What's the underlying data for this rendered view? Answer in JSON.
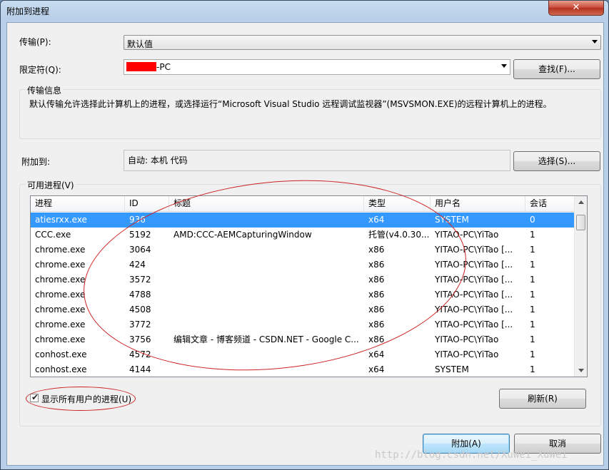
{
  "window": {
    "title": "附加到进程",
    "close_glyph": "✕"
  },
  "transport": {
    "label": "传输(P):",
    "value": "默认值"
  },
  "qualifier": {
    "label": "限定符(Q):",
    "value": "-PC",
    "find_button": "查找(F)..."
  },
  "transport_info": {
    "title": "传输信息",
    "text": "默认传输允许选择此计算机上的进程，或选择运行“Microsoft Visual Studio 远程调试监视器”(MSVSMON.EXE)的远程计算机上的进程。"
  },
  "attach_to": {
    "label": "附加到:",
    "value": "自动: 本机 代码",
    "select_button": "选择(S)..."
  },
  "processes": {
    "title": "可用进程(V)",
    "columns": [
      "进程",
      "ID",
      "标题",
      "类型",
      "用户名",
      "会话"
    ],
    "rows": [
      {
        "name": "atiesrxx.exe",
        "id": "936",
        "title": "",
        "type": "x64",
        "user": "SYSTEM",
        "session": "0"
      },
      {
        "name": "CCC.exe",
        "id": "5192",
        "title": "AMD:CCC-AEMCapturingWindow",
        "type": "托管(v4.0.30...",
        "user": "YITAO-PC\\YiTao",
        "session": "1"
      },
      {
        "name": "chrome.exe",
        "id": "3064",
        "title": "",
        "type": "x86",
        "user": "YITAO-PC\\YiTao [...",
        "session": "1"
      },
      {
        "name": "chrome.exe",
        "id": "424",
        "title": "",
        "type": "x86",
        "user": "YITAO-PC\\YiTao [...",
        "session": "1"
      },
      {
        "name": "chrome.exe",
        "id": "3572",
        "title": "",
        "type": "x86",
        "user": "YITAO-PC\\YiTao [...",
        "session": "1"
      },
      {
        "name": "chrome.exe",
        "id": "4788",
        "title": "",
        "type": "x86",
        "user": "YITAO-PC\\YiTao [...",
        "session": "1"
      },
      {
        "name": "chrome.exe",
        "id": "4508",
        "title": "",
        "type": "x86",
        "user": "YITAO-PC\\YiTao [...",
        "session": "1"
      },
      {
        "name": "chrome.exe",
        "id": "3772",
        "title": "",
        "type": "x86",
        "user": "YITAO-PC\\YiTao [...",
        "session": "1"
      },
      {
        "name": "chrome.exe",
        "id": "3756",
        "title": "编辑文章 - 博客频道 - CSDN.NET - Google C...",
        "type": "x86",
        "user": "YITAO-PC\\YiTao",
        "session": "1"
      },
      {
        "name": "conhost.exe",
        "id": "4572",
        "title": "",
        "type": "x64",
        "user": "YITAO-PC\\YiTao",
        "session": "1"
      },
      {
        "name": "conhost.exe",
        "id": "4144",
        "title": "",
        "type": "x64",
        "user": "SYSTEM",
        "session": "1"
      }
    ],
    "selected_index": 0,
    "show_all_users": {
      "label": "显示所有用户的进程(U)",
      "checked": true
    },
    "refresh_button": "刷新(R)"
  },
  "footer": {
    "attach_button": "附加(A)",
    "cancel_button": "取消"
  },
  "watermark": "http://blog.csdn.net/XuWei_XuWei",
  "colors": {
    "selection": "#3399ff",
    "annotation": "#cc2222",
    "redaction": "#ff0000"
  }
}
